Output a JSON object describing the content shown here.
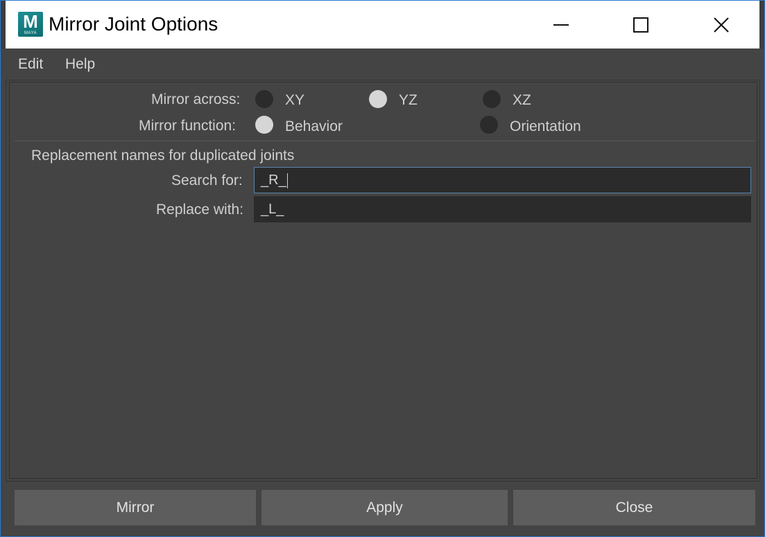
{
  "window": {
    "title": "Mirror Joint Options",
    "app_icon_letter": "M",
    "app_icon_text": "MAYA",
    "controls": [
      "minimize-icon",
      "maximize-icon",
      "close-icon"
    ]
  },
  "menu": {
    "items": [
      {
        "label": "Edit"
      },
      {
        "label": "Help"
      }
    ]
  },
  "mirror_across": {
    "label": "Mirror across:",
    "options": [
      {
        "label": "XY",
        "selected": false
      },
      {
        "label": "YZ",
        "selected": true
      },
      {
        "label": "XZ",
        "selected": false
      }
    ]
  },
  "mirror_function": {
    "label": "Mirror function:",
    "options": [
      {
        "label": "Behavior",
        "selected": true
      },
      {
        "label": "Orientation",
        "selected": false
      }
    ]
  },
  "replacement": {
    "section_title": "Replacement names for duplicated joints",
    "search_label": "Search for:",
    "search_value": "_R_",
    "replace_label": "Replace with:",
    "replace_value": "_L_"
  },
  "buttons": {
    "mirror": "Mirror",
    "apply": "Apply",
    "close": "Close"
  },
  "colors": {
    "background": "#444444",
    "button": "#5d5d5d",
    "field": "#2b2b2b",
    "radio_selected": "#d6d6d6",
    "radio_unselected": "#2b2b2b",
    "focus_border": "#5a86b0",
    "window_border": "#2b7ad0"
  }
}
